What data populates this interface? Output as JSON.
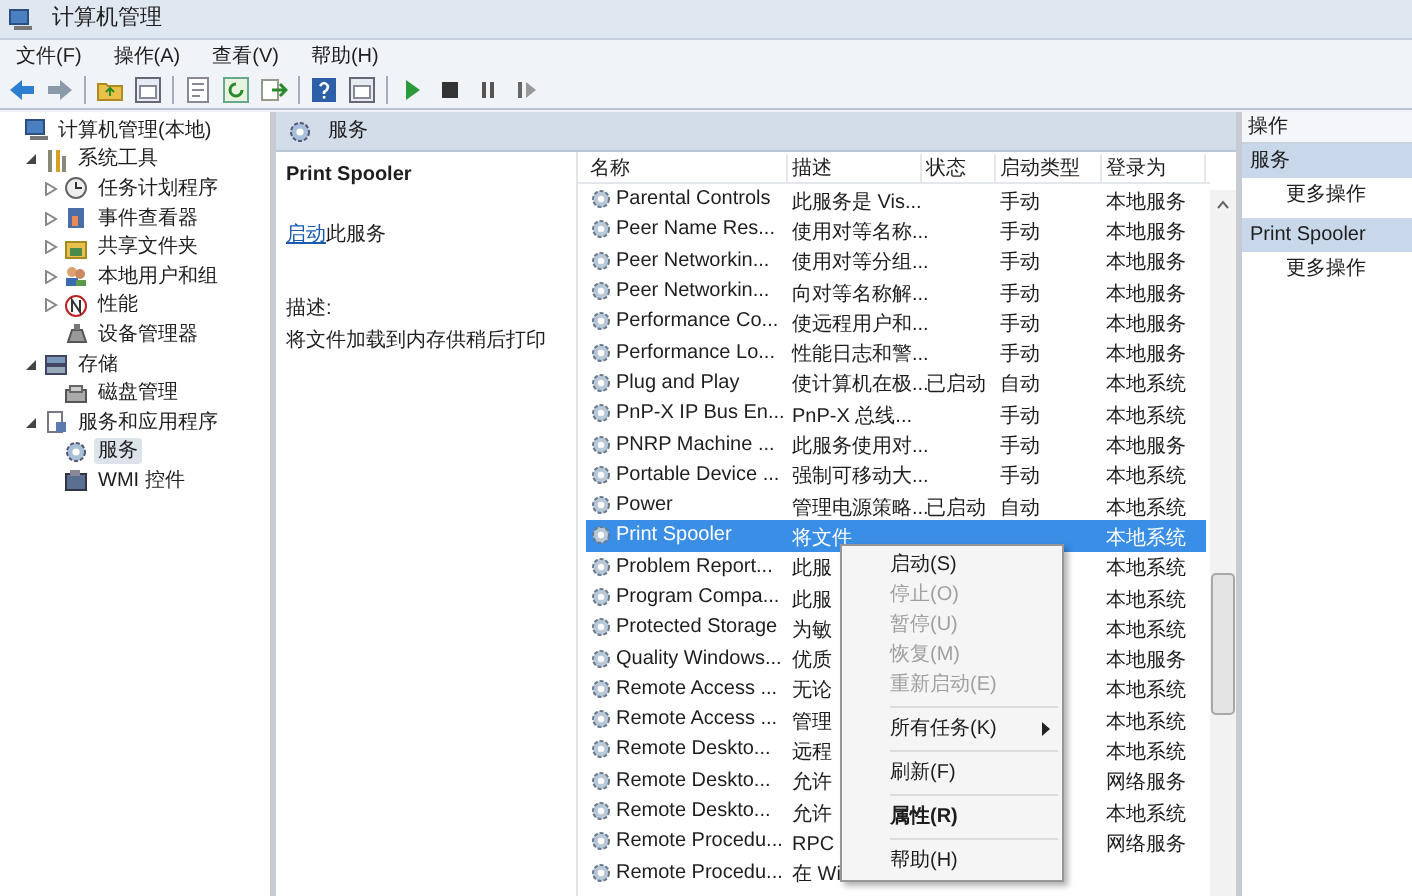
{
  "window": {
    "title": "计算机管理"
  },
  "menu": [
    "文件(F)",
    "操作(A)",
    "查看(V)",
    "帮助(H)"
  ],
  "tree": [
    {
      "label": "计算机管理(本地)",
      "selected": false,
      "children": [
        {
          "label": "系统工具",
          "selected": false,
          "expanded": true,
          "children": [
            {
              "label": "任务计划程序",
              "selected": false,
              "expanded": false
            },
            {
              "label": "事件查看器",
              "selected": false,
              "expanded": false
            },
            {
              "label": "共享文件夹",
              "selected": false,
              "expanded": false
            },
            {
              "label": "本地用户和组",
              "selected": false,
              "expanded": false
            },
            {
              "label": "性能",
              "selected": false,
              "expanded": false
            },
            {
              "label": "设备管理器",
              "selected": false
            }
          ]
        },
        {
          "label": "存储",
          "selected": false,
          "expanded": true,
          "children": [
            {
              "label": "磁盘管理",
              "selected": false
            }
          ]
        },
        {
          "label": "服务和应用程序",
          "selected": false,
          "expanded": true,
          "children": [
            {
              "label": "服务",
              "selected": true
            },
            {
              "label": "WMI 控件",
              "selected": false
            }
          ]
        }
      ]
    }
  ],
  "panel_header": "服务",
  "detail": {
    "title": "Print Spooler",
    "action_link": "启动",
    "action_text": "此服务",
    "description_label": "描述:",
    "description": "将文件加载到内存供稍后打印"
  },
  "table": {
    "columns": [
      "名称",
      "描述",
      "状态",
      "启动类型",
      "登录为"
    ],
    "rows": [
      {
        "name": "Parental Controls",
        "description": "此服务是 Vis...",
        "status": "",
        "startup": "手动",
        "logon": "本地服务",
        "selected": false
      },
      {
        "name": "Peer Name Res...",
        "description": "使用对等名称...",
        "status": "",
        "startup": "手动",
        "logon": "本地服务",
        "selected": false
      },
      {
        "name": "Peer Networkin...",
        "description": "使用对等分组...",
        "status": "",
        "startup": "手动",
        "logon": "本地服务",
        "selected": false
      },
      {
        "name": "Peer Networkin...",
        "description": "向对等名称解...",
        "status": "",
        "startup": "手动",
        "logon": "本地服务",
        "selected": false
      },
      {
        "name": "Performance Co...",
        "description": "使远程用户和...",
        "status": "",
        "startup": "手动",
        "logon": "本地服务",
        "selected": false
      },
      {
        "name": "Performance Lo...",
        "description": "性能日志和警...",
        "status": "",
        "startup": "手动",
        "logon": "本地服务",
        "selected": false
      },
      {
        "name": "Plug and Play",
        "description": "使计算机在极...",
        "status": "已启动",
        "startup": "自动",
        "logon": "本地系统",
        "selected": false
      },
      {
        "name": "PnP-X IP Bus En...",
        "description": "PnP-X 总线...",
        "status": "",
        "startup": "手动",
        "logon": "本地系统",
        "selected": false
      },
      {
        "name": "PNRP Machine ...",
        "description": "此服务使用对...",
        "status": "",
        "startup": "手动",
        "logon": "本地服务",
        "selected": false
      },
      {
        "name": "Portable Device ...",
        "description": "强制可移动大...",
        "status": "",
        "startup": "手动",
        "logon": "本地系统",
        "selected": false
      },
      {
        "name": "Power",
        "description": "管理电源策略...",
        "status": "已启动",
        "startup": "自动",
        "logon": "本地系统",
        "selected": false
      },
      {
        "name": "Print Spooler",
        "description": "将文件",
        "status": "",
        "startup": "",
        "logon": "本地系统",
        "selected": true
      },
      {
        "name": "Problem Report...",
        "description": "此服",
        "status": "",
        "startup": "",
        "logon": "本地系统",
        "selected": false
      },
      {
        "name": "Program Compa...",
        "description": "此服",
        "status": "",
        "startup": "",
        "logon": "本地系统",
        "selected": false
      },
      {
        "name": "Protected Storage",
        "description": "为敏",
        "status": "",
        "startup": "",
        "logon": "本地系统",
        "selected": false
      },
      {
        "name": "Quality Windows...",
        "description": "优质",
        "status": "",
        "startup": "",
        "logon": "本地服务",
        "selected": false
      },
      {
        "name": "Remote Access ...",
        "description": "无论",
        "status": "",
        "startup": "",
        "logon": "本地系统",
        "selected": false
      },
      {
        "name": "Remote Access ...",
        "description": "管理",
        "status": "",
        "startup": "",
        "logon": "本地系统",
        "selected": false
      },
      {
        "name": "Remote Deskto...",
        "description": "远程",
        "status": "",
        "startup": "",
        "logon": "本地系统",
        "selected": false
      },
      {
        "name": "Remote Deskto...",
        "description": "允许",
        "status": "",
        "startup": "",
        "logon": "网络服务",
        "selected": false
      },
      {
        "name": "Remote Deskto...",
        "description": "允许",
        "status": "",
        "startup": "",
        "logon": "本地系统",
        "selected": false
      },
      {
        "name": "Remote Procedu...",
        "description": "RPC",
        "status": "",
        "startup": "",
        "logon": "网络服务",
        "selected": false
      },
      {
        "name": "Remote Procedu...",
        "description": "在 Wi",
        "status": "",
        "startup": "",
        "logon": "",
        "selected": false
      }
    ]
  },
  "context_menu": [
    {
      "kind": "item",
      "label": "启动(S)",
      "disabled": false,
      "bold": false
    },
    {
      "kind": "item",
      "label": "停止(O)",
      "disabled": true,
      "bold": false
    },
    {
      "kind": "item",
      "label": "暂停(U)",
      "disabled": true,
      "bold": false
    },
    {
      "kind": "item",
      "label": "恢复(M)",
      "disabled": true,
      "bold": false
    },
    {
      "kind": "item",
      "label": "重新启动(E)",
      "disabled": true,
      "bold": false
    },
    {
      "kind": "separator"
    },
    {
      "kind": "submenu",
      "label": "所有任务(K)",
      "disabled": false,
      "bold": false
    },
    {
      "kind": "separator"
    },
    {
      "kind": "item",
      "label": "刷新(F)",
      "disabled": false,
      "bold": false
    },
    {
      "kind": "separator"
    },
    {
      "kind": "item",
      "label": "属性(R)",
      "disabled": false,
      "bold": true
    },
    {
      "kind": "separator"
    },
    {
      "kind": "item",
      "label": "帮助(H)",
      "disabled": false,
      "bold": false
    }
  ],
  "actions": {
    "title": "操作",
    "sections": [
      {
        "header": "服务",
        "items": [
          "更多操作"
        ]
      },
      {
        "header": "Print Spooler",
        "items": [
          "更多操作"
        ]
      }
    ]
  }
}
